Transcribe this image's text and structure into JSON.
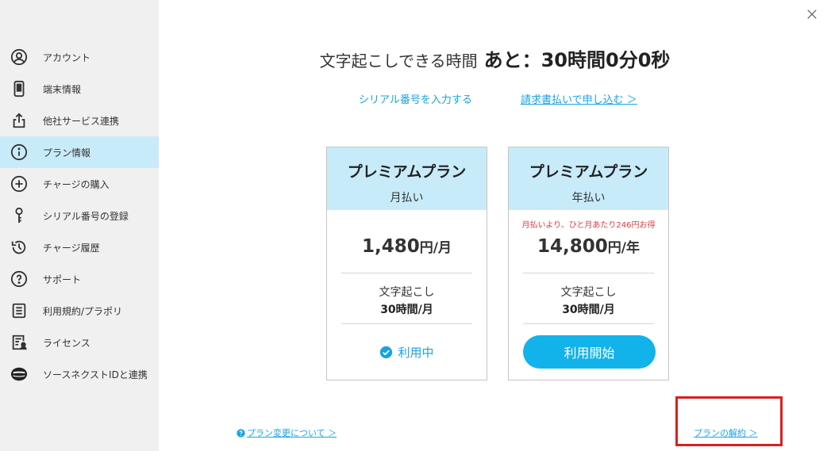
{
  "sidebar": {
    "items": [
      {
        "label": "アカウント",
        "icon": "account-icon",
        "active": false
      },
      {
        "label": "端末情報",
        "icon": "device-icon",
        "active": false
      },
      {
        "label": "他社サービス連携",
        "icon": "share-icon",
        "active": false
      },
      {
        "label": "プラン情報",
        "icon": "info-icon",
        "active": true
      },
      {
        "label": "チャージの購入",
        "icon": "plus-circle-icon",
        "active": false
      },
      {
        "label": "シリアル番号の登録",
        "icon": "key-icon",
        "active": false
      },
      {
        "label": "チャージ履歴",
        "icon": "history-icon",
        "active": false
      },
      {
        "label": "サポート",
        "icon": "help-icon",
        "active": false
      },
      {
        "label": "利用規約/プラポリ",
        "icon": "document-icon",
        "active": false
      },
      {
        "label": "ライセンス",
        "icon": "license-icon",
        "active": false
      },
      {
        "label": "ソースネクストIDと連携",
        "icon": "sourcenext-logo-icon",
        "active": false
      }
    ]
  },
  "header": {
    "time_label": "文字起こしできる時間",
    "time_value": "あと：30時間0分0秒"
  },
  "links": {
    "serial": "シリアル番号を入力する",
    "invoice": "請求書払いで申し込む ＞"
  },
  "plans": [
    {
      "name": "プレミアムプラン",
      "period": "月払い",
      "price": "1,480",
      "price_unit": "円/月",
      "feature_label": "文字起こし",
      "feature_value": "30時間/月",
      "status": "利用中"
    },
    {
      "name": "プレミアムプラン",
      "period": "年払い",
      "promo": "月払いより、ひと月あたり246円お得",
      "price": "14,800",
      "price_unit": "円/年",
      "feature_label": "文字起こし",
      "feature_value": "30時間/月",
      "button": "利用開始"
    }
  ],
  "footer": {
    "change_link": "プラン変更について ＞",
    "cancel_link": "プランの解約 ＞"
  },
  "colors": {
    "accent": "#12b3ea",
    "link": "#1aa3e0",
    "card_head": "#c8ebfa",
    "active_bg": "#c8ebfa",
    "promo": "#e03a3a",
    "highlight": "#d81f1f"
  }
}
